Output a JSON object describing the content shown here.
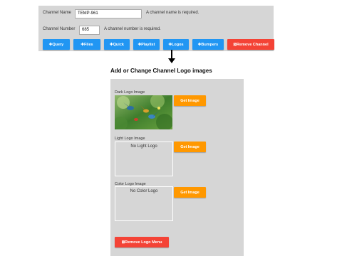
{
  "channel_form": {
    "name_label": "Channel Name",
    "name_value": "TEMP-961",
    "name_note": "A channel name is required.",
    "number_label": "Channel Number",
    "number_value": "685",
    "number_note": "A channel number is required."
  },
  "buttons": [
    {
      "label": "✚Query",
      "color": "#2196f3"
    },
    {
      "label": "✚Files",
      "color": "#2196f3"
    },
    {
      "label": "✚Quick",
      "color": "#2196f3"
    },
    {
      "label": "✚Playlist",
      "color": "#2196f3"
    },
    {
      "label": "✚Logos",
      "color": "#2196f3"
    },
    {
      "label": "✚Bumpers",
      "color": "#2196f3"
    },
    {
      "label": "⊠Remove Channel",
      "color": "#f44336"
    }
  ],
  "logo_menu": {
    "title": "Add or Change Channel Logo images",
    "dark": {
      "label": "Dark Logo Image",
      "button": "Get Image"
    },
    "light": {
      "label": "Light Logo Image",
      "placeholder": "No Light Logo",
      "button": "Get Image"
    },
    "color": {
      "label": "Color Logo Image",
      "placeholder": "No Color Logo",
      "button": "Get Image"
    },
    "remove_button": "⊠Remove Logo Menu"
  },
  "icons": {
    "arrow": "arrow-down-icon",
    "bird_image": "hummingbird-image"
  }
}
